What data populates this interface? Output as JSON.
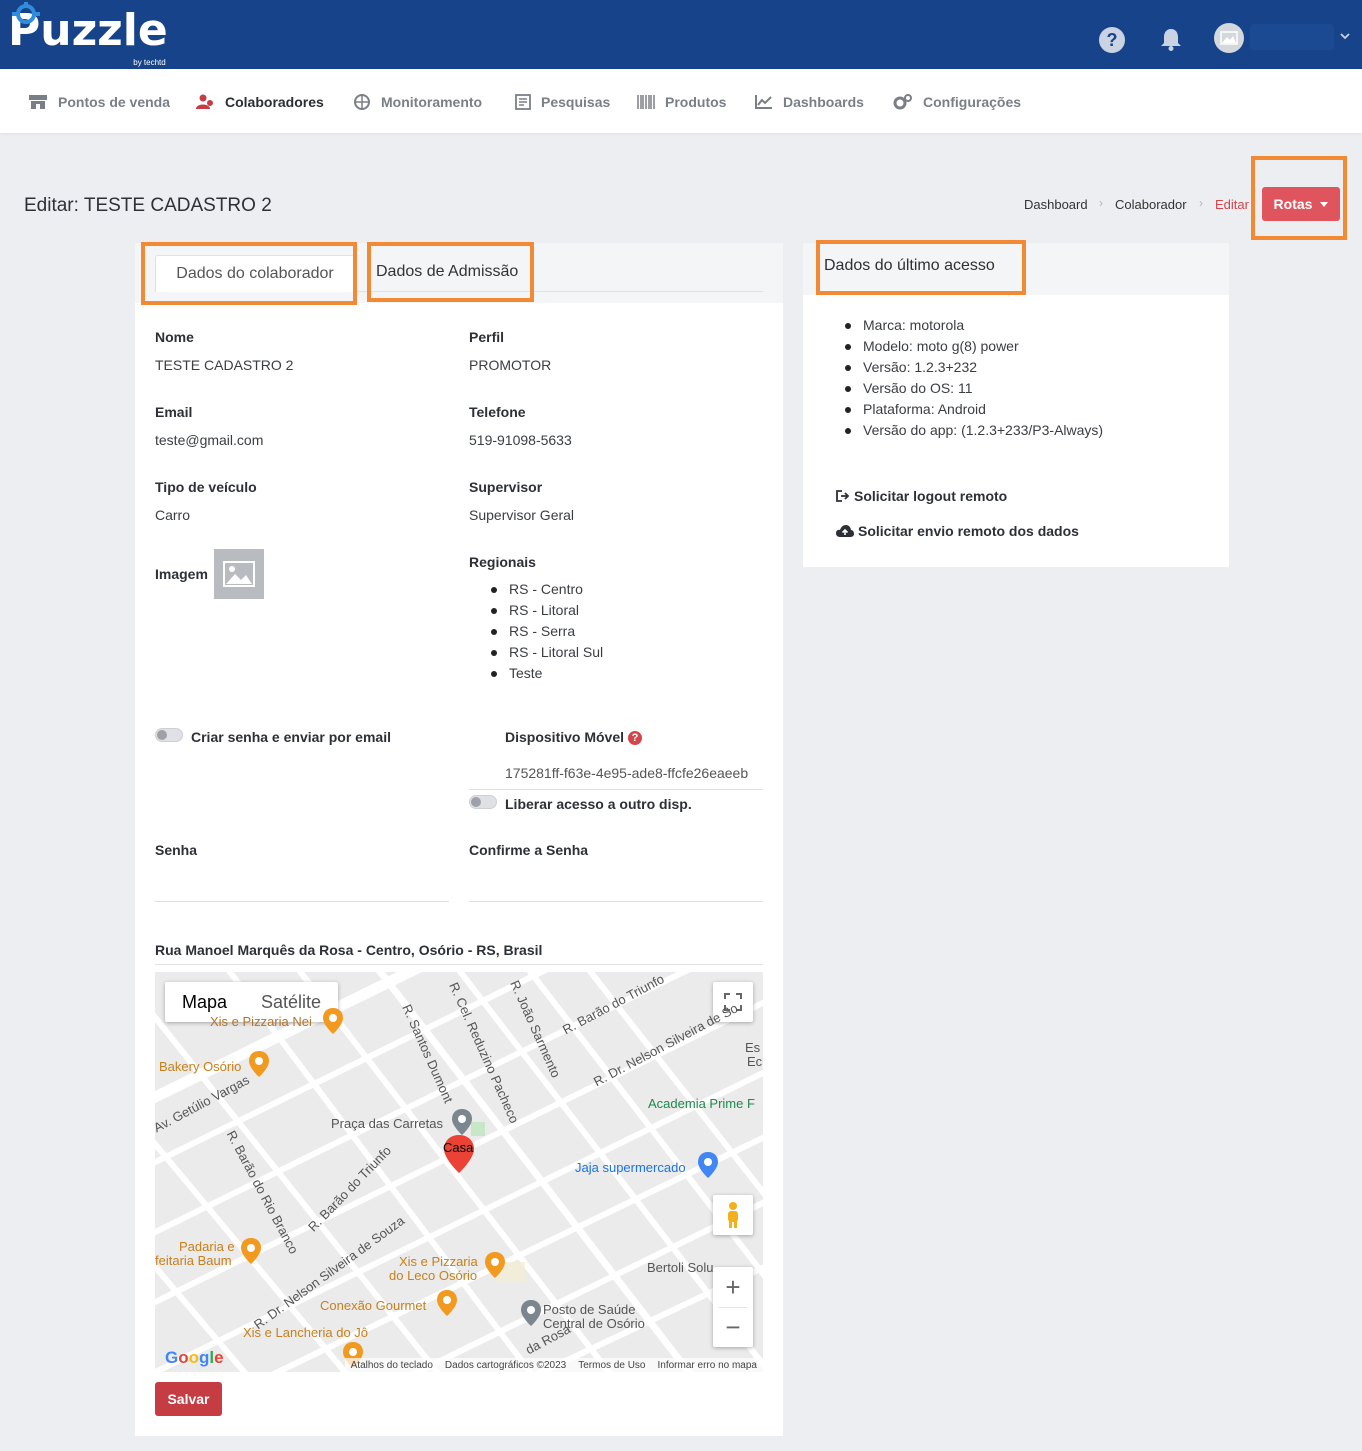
{
  "app": {
    "logo_text": "Puzzle",
    "logo_sub": "by techtd"
  },
  "nav": {
    "items": [
      {
        "label": "Pontos de venda",
        "icon": "store-icon"
      },
      {
        "label": "Colaboradores",
        "icon": "users-icon"
      },
      {
        "label": "Monitoramento",
        "icon": "crosshair-icon"
      },
      {
        "label": "Pesquisas",
        "icon": "survey-icon"
      },
      {
        "label": "Produtos",
        "icon": "barcode-icon"
      },
      {
        "label": "Dashboards",
        "icon": "chart-line-icon"
      },
      {
        "label": "Configurações",
        "icon": "gears-icon"
      }
    ]
  },
  "page": {
    "title": "Editar: TESTE CADASTRO 2",
    "breadcrumb": [
      "Dashboard",
      "Colaborador",
      "Editar"
    ],
    "rotas_label": "Rotas"
  },
  "tabs": {
    "tab1": "Dados do colaborador",
    "tab2": "Dados de Admissão"
  },
  "form": {
    "nome_label": "Nome",
    "nome_value": "TESTE CADASTRO 2",
    "perfil_label": "Perfil",
    "perfil_value": "PROMOTOR",
    "email_label": "Email",
    "email_value": "teste@gmail.com",
    "telefone_label": "Telefone",
    "telefone_value": "519-91098-5633",
    "veiculo_label": "Tipo de veículo",
    "veiculo_value": "Carro",
    "supervisor_label": "Supervisor",
    "supervisor_value": "Supervisor Geral",
    "imagem_label": "Imagem",
    "regionais_label": "Regionais",
    "regionais": [
      "RS - Centro",
      "RS - Litoral",
      "RS - Serra",
      "RS - Litoral Sul",
      "Teste"
    ],
    "criar_senha_label": "Criar senha e enviar por email",
    "dispositivo_label": "Dispositivo Móvel",
    "dispositivo_id": "175281ff-f63e-4e95-ade8-ffcfe26eaeeb",
    "liberar_label": "Liberar acesso a outro disp.",
    "senha_label": "Senha",
    "senha_value": "",
    "confirme_label": "Confirme a Senha",
    "confirme_value": "",
    "address": "Rua Manoel Marquês da Rosa - Centro, Osório - RS, Brasil",
    "save_label": "Salvar"
  },
  "map": {
    "type_map": "Mapa",
    "type_satellite": "Satélite",
    "marker_label": "Casa",
    "logo": "Google",
    "footer": [
      "Atalhos do teclado",
      "Dados cartográficos ©2023",
      "Termos de Uso",
      "Informar erro no mapa"
    ],
    "labels": {
      "pizzaria_nei": "Xis e Pizzaria Nei",
      "bakery": "Bakery Osório",
      "getulio": "Av. Getúlio Vargas",
      "rio_branco": "R. Barão do Rio Branco",
      "santos_dumont": "R. Santos Dumont",
      "reduzino": "R. Cel. Reduzino Pacheco",
      "joao_sarmento": "R. João Sarmento",
      "barao_triunfo_top": "R. Barão do Triunfo",
      "nelson_top": "R. Dr. Nelson Silveira de So",
      "praca": "Praça das Carretas",
      "academia": "Academia Prime F",
      "jaja": "Jaja supermercado",
      "barao_triunfo_mid": "R. Barão do Triunfo",
      "nelson_mid": "R. Dr. Nelson Silveira de Souza",
      "padaria": "Padaria e",
      "padaria2": "feitaria Baum",
      "leco": "Xis e Pizzaria",
      "leco2": "do Leco Osório",
      "bertoli": "Bertoli Solu",
      "conexao": "Conexão Gourmet",
      "posto": "Posto de Saúde",
      "posto2": "Central de Osório",
      "lancheria": "Xis e Lancheria do Jô",
      "rosa": "da Rosa",
      "es": "Es",
      "ec": "Ec"
    }
  },
  "access": {
    "title": "Dados do último acesso",
    "items": [
      "Marca: motorola",
      "Modelo: moto g(8) power",
      "Versão: 1.2.3+232",
      "Versão do OS: 11",
      "Plataforma: Android",
      "Versão do app: (1.2.3+233/P3-Always)"
    ],
    "logout_label": "Solicitar logout remoto",
    "upload_label": "Solicitar envio remoto dos dados"
  },
  "colors": {
    "topbar": "#164389",
    "accent_red": "#e0545e",
    "highlight": "#f28935"
  }
}
